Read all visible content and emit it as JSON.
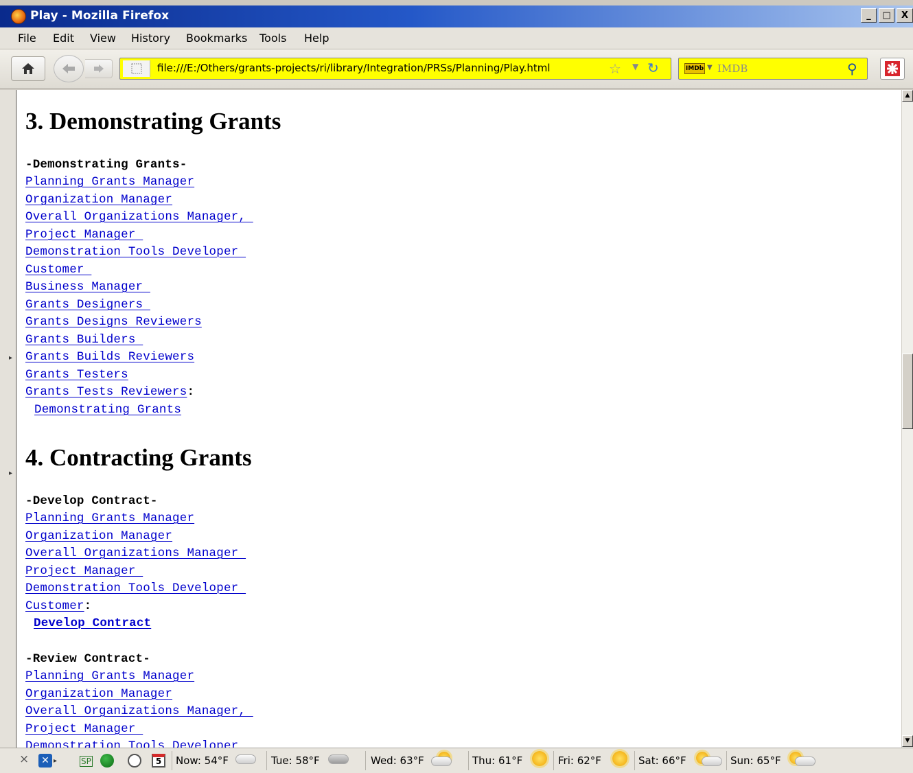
{
  "window": {
    "title": "Play - Mozilla Firefox",
    "controls": [
      "_",
      "□",
      "X"
    ]
  },
  "menubar": {
    "items": [
      "File",
      "Edit",
      "View",
      "History",
      "Bookmarks",
      "Tools",
      "Help"
    ]
  },
  "navbar": {
    "url": "file:///E:/Others/grants-projects/ri/library/Integration/PRSs/Planning/Play.html",
    "search_placeholder": "IMDB",
    "search_engine": "IMDb"
  },
  "content": {
    "section3": {
      "heading": "3. Demonstrating Grants",
      "block": {
        "label": "-Demonstrating Grants-",
        "links": [
          "Planning Grants Manager",
          "Organization Manager",
          "Overall Organizations Manager, ",
          "Project Manager ",
          "Demonstration Tools Developer ",
          "Customer ",
          "Business Manager ",
          "Grants Designers ",
          "Grants Designs Reviewers",
          "Grants Builders ",
          "Grants Builds Reviewers",
          "Grants Testers",
          "Grants Tests Reviewers"
        ],
        "colon": ":",
        "action": "Demonstrating Grants"
      }
    },
    "section4": {
      "heading": "4. Contracting Grants",
      "block1": {
        "label": "-Develop Contract-",
        "links": [
          "Planning Grants Manager",
          "Organization Manager",
          "Overall Organizations Manager ",
          "Project Manager ",
          "Demonstration Tools Developer ",
          "Customer"
        ],
        "colon": ":",
        "action": "Develop Contract"
      },
      "block2": {
        "label": "-Review Contract-",
        "links": [
          "Planning Grants Manager",
          "Organization Manager",
          "Overall Organizations Manager, ",
          "Project Manager ",
          "Demonstration Tools Developer"
        ]
      }
    }
  },
  "statusbar": {
    "close": "×",
    "sp_label": "SP",
    "calendar_day": "5",
    "forecast": [
      {
        "label": "Now: 54°F",
        "icon": "cloud-icon"
      },
      {
        "label": "Tue: 58°F",
        "icon": "rain-cloud-icon"
      },
      {
        "label": "Wed: 63°F",
        "icon": "partly-sunny-icon"
      },
      {
        "label": "Thu: 61°F",
        "icon": "sun-icon"
      },
      {
        "label": "Fri: 62°F",
        "icon": "sun-icon"
      },
      {
        "label": "Sat: 66°F",
        "icon": "partly-sunny-icon"
      },
      {
        "label": "Sun: 65°F",
        "icon": "partly-sunny-icon"
      }
    ]
  },
  "colors": {
    "link": "#0000cc",
    "url_bar_bg": "#ffff00",
    "titlebar_start": "#0a2a8c",
    "titlebar_end": "#a8c4ee"
  }
}
